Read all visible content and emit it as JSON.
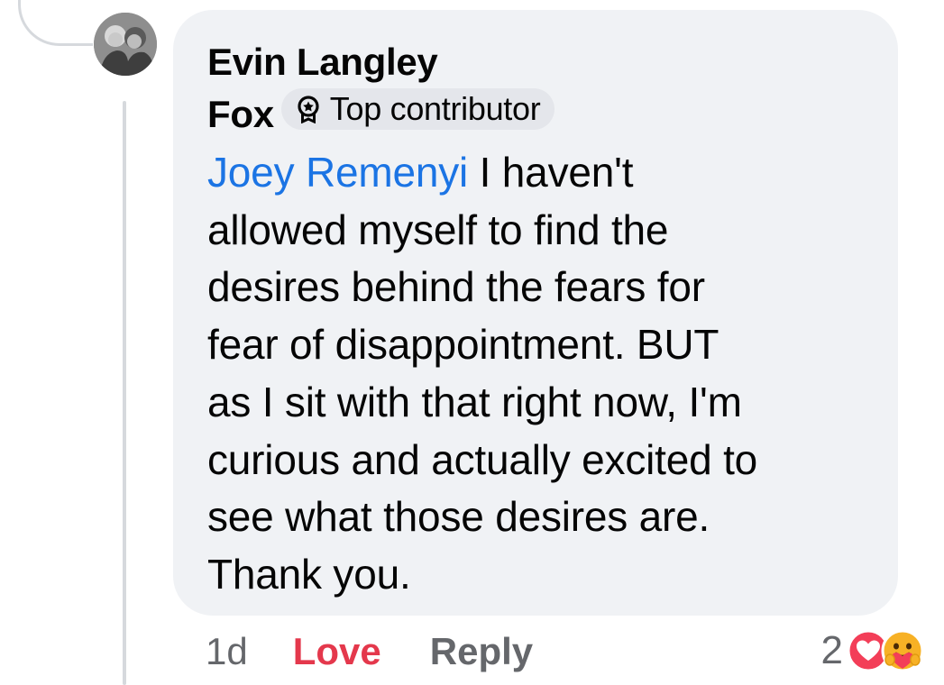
{
  "comment": {
    "author_first": "Evin Langley",
    "author_last": "Fox",
    "badge_label": "Top contributor",
    "mention": "Joey Remenyi",
    "text": " I haven't\nallowed myself to find the\ndesires behind the fears for\nfear of disappointment. BUT\nas I sit with  that right now, I'm\ncurious and actually excited to\nsee what those desires are.\nThank you."
  },
  "actions": {
    "time": "1d",
    "love_label": "Love",
    "reply_label": "Reply"
  },
  "reactions": {
    "count": "2",
    "icons": [
      "heart-icon",
      "care-icon"
    ]
  },
  "colors": {
    "bubble": "#f0f2f5",
    "mention": "#1b74e4",
    "love": "#e4384c",
    "secondary_text": "#65676b"
  }
}
